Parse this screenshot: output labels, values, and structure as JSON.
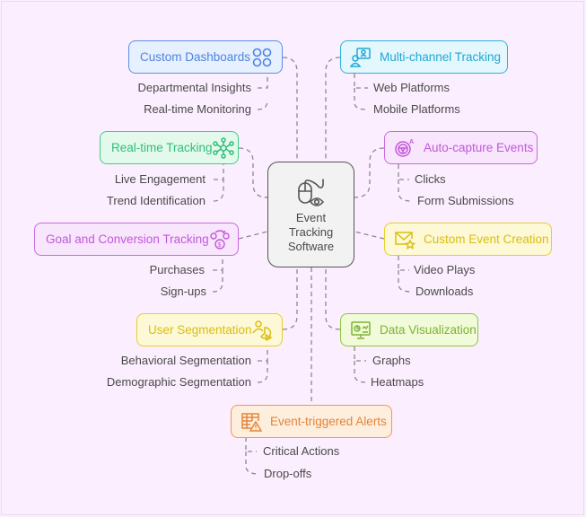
{
  "center": {
    "title_lines": [
      "Event",
      "Tracking",
      "Software"
    ],
    "icon": "mouse-eye-icon"
  },
  "branches": [
    {
      "id": "custom-dashboards",
      "label": "Custom Dashboards",
      "icon": "grid-circles-icon",
      "color": "#5b8fe5",
      "items": [
        "Departmental Insights",
        "Real-time Monitoring"
      ]
    },
    {
      "id": "multi-channel-tracking",
      "label": "Multi-channel Tracking",
      "icon": "user-monitor-icon",
      "color": "#2bb3dd",
      "items": [
        "Web Platforms",
        "Mobile Platforms"
      ]
    },
    {
      "id": "real-time-tracking",
      "label": "Real-time Tracking",
      "icon": "network-nodes-icon",
      "color": "#3fcf87",
      "items": [
        "Live Engagement",
        "Trend Identification"
      ]
    },
    {
      "id": "auto-capture-events",
      "label": "Auto-capture Events",
      "icon": "steering-auto-icon",
      "color": "#c96ae0",
      "items": [
        "Clicks",
        "Form Submissions"
      ]
    },
    {
      "id": "goal-conversion-tracking",
      "label": "Goal and Conversion Tracking",
      "icon": "money-exchange-icon",
      "color": "#c96ae0",
      "items": [
        "Purchases",
        "Sign-ups"
      ]
    },
    {
      "id": "custom-event-creation",
      "label": "Custom Event Creation",
      "icon": "envelope-star-icon",
      "color": "#e5cf2c",
      "items": [
        "Video Plays",
        "Downloads"
      ]
    },
    {
      "id": "user-segmentation",
      "label": "User Segmentation",
      "icon": "user-pie-icon",
      "color": "#e5cf2c",
      "items": [
        "Behavioral Segmentation",
        "Demographic Segmentation"
      ]
    },
    {
      "id": "data-visualization",
      "label": "Data Visualization",
      "icon": "monitor-chart-icon",
      "color": "#8ec63f",
      "items": [
        "Graphs",
        "Heatmaps"
      ]
    },
    {
      "id": "event-triggered-alerts",
      "label": "Event-triggered Alerts",
      "icon": "table-warning-icon",
      "color": "#ec9a52",
      "items": [
        "Critical Actions",
        "Drop-offs"
      ]
    }
  ]
}
